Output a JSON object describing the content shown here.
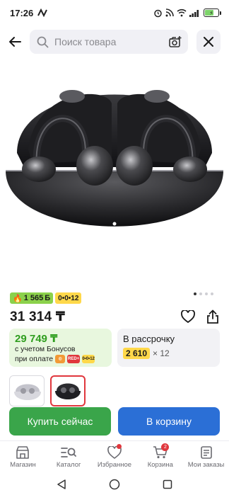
{
  "status_bar": {
    "time": "17:26",
    "battery_level": 0.6,
    "battery_color": "#7dd36a"
  },
  "search": {
    "placeholder": "Поиск товара",
    "icons": [
      "arrow-left-icon",
      "search-icon",
      "camera-plus-icon",
      "close-icon"
    ]
  },
  "product": {
    "image_icon": "earbuds-case-image",
    "gallery": {
      "total": 4,
      "active": 0
    },
    "badges": {
      "bonus_value": "1 565",
      "bonus_icon": "flame-icon",
      "installment": "0•0•12",
      "bonus_color": "#8bd14b",
      "installment_color": "#ffd84a"
    },
    "price": "31 314 ₸",
    "price_actions": [
      "heart-icon",
      "share-icon"
    ]
  },
  "offers": {
    "bonus_card": {
      "value": "29 749 ₸",
      "line1": "с учетом Бонусов",
      "line2": "при оплате",
      "logos": [
        "kaspi",
        "RED+",
        "0•0•12"
      ],
      "color": "#2f9e1f"
    },
    "installment_card": {
      "title": "В рассрочку",
      "amount": "2 610",
      "multiplier": "× 12"
    }
  },
  "variants": [
    {
      "name": "silver",
      "selected": false
    },
    {
      "name": "black",
      "selected": true
    }
  ],
  "actions": {
    "buy_now": "Купить сейчас",
    "add_to_cart": "В корзину",
    "buy_color": "#3aa54a",
    "cart_color": "#2b6fd6"
  },
  "bottom_nav": {
    "items": [
      {
        "label": "Магазин",
        "icon": "store-icon"
      },
      {
        "label": "Каталог",
        "icon": "catalog-search-icon"
      },
      {
        "label": "Избранное",
        "icon": "heart-icon",
        "dot": true
      },
      {
        "label": "Корзина",
        "icon": "cart-icon",
        "count": "2"
      },
      {
        "label": "Мои заказы",
        "icon": "orders-icon"
      }
    ]
  },
  "system_nav": [
    "back-triangle-icon",
    "home-circle-icon",
    "recents-square-icon"
  ]
}
